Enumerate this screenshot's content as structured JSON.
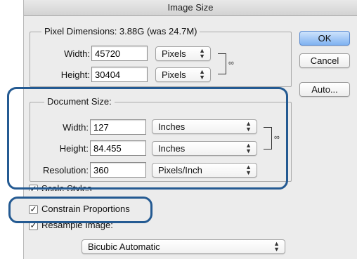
{
  "window": {
    "title": "Image Size"
  },
  "pixel_dimensions": {
    "legend": "Pixel Dimensions:  3.88G (was 24.7M)",
    "width": {
      "label": "Width:",
      "value": "45720",
      "unit": "Pixels"
    },
    "height": {
      "label": "Height:",
      "value": "30404",
      "unit": "Pixels"
    }
  },
  "document_size": {
    "legend": "Document Size:",
    "width": {
      "label": "Width:",
      "value": "127",
      "unit": "Inches"
    },
    "height": {
      "label": "Height:",
      "value": "84.455",
      "unit": "Inches"
    },
    "resolution": {
      "label": "Resolution:",
      "value": "360",
      "unit": "Pixels/Inch"
    }
  },
  "options": {
    "scale_styles": {
      "label": "Scale Styles",
      "checked": true
    },
    "constrain_proportions": {
      "label": "Constrain Proportions",
      "checked": true
    },
    "resample_image": {
      "label": "Resample Image:",
      "checked": true
    },
    "resample_method": "Bicubic Automatic"
  },
  "buttons": {
    "ok": "OK",
    "cancel": "Cancel",
    "auto": "Auto..."
  },
  "glyphs": {
    "check": "✓",
    "link": "🔗",
    "up_down": "⌃⌄"
  },
  "colors": {
    "highlight": "#245a92",
    "default_button": "#7fb2f1"
  }
}
